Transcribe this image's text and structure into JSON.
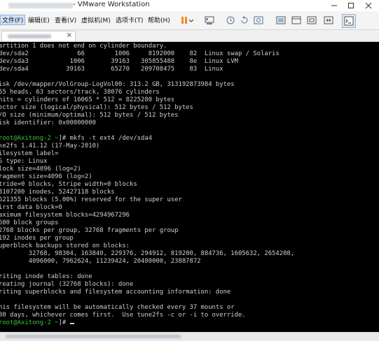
{
  "window": {
    "title": "VMware Workstation",
    "minimize_icon": "minimize-icon",
    "maximize_icon": "maximize-icon",
    "close_icon": "close-icon"
  },
  "menu": {
    "items": [
      "文件(F)",
      "编辑(E)",
      "查看(V)",
      "虚拟机(M)",
      "选项卡(T)",
      "帮助(H)"
    ],
    "active_index": 0
  },
  "toolbar": {
    "icons": [
      "pause-icon",
      "dropdown-icon",
      "send-ctrl-alt-del-icon",
      "snapshot-icon",
      "revert-snapshot-icon",
      "snapshot-manager-icon",
      "fullscreen-icon",
      "unity-icon",
      "console-view-icon",
      "stretch-icon",
      "terminal-icon"
    ],
    "pause_color": "#f28c1e"
  },
  "tab": {
    "close_label": "×"
  },
  "terminal": {
    "prompt_color": "#3cc53c",
    "text_color": "#cfcfcf",
    "lines": [
      {
        "text": "artition 1 does not end on cylinder boundary."
      },
      {
        "text": "dev/sda2             66        1006     8192000    82  Linux swap / Solaris"
      },
      {
        "text": "dev/sda3           1006       39163   305855488    8e  Linux LVM"
      },
      {
        "text": "dev/sda4          39163       65270   209708475    83  Linux"
      },
      {
        "text": ""
      },
      {
        "text": "isk /dev/mapper/VolGroup-LogVol00: 313.2 GB, 313192873984 bytes"
      },
      {
        "text": "55 heads, 63 sectors/track, 38076 cylinders"
      },
      {
        "text": "nits = cylinders of 16065 * 512 = 8225280 bytes"
      },
      {
        "text": "ector size (logical/physical): 512 bytes / 512 bytes"
      },
      {
        "text": "/O size (minimum/optimal): 512 bytes / 512 bytes"
      },
      {
        "text": "isk identifier: 0x00000000"
      },
      {
        "text": ""
      },
      {
        "prompt": "root@Axitong-2 ~",
        "text": "]# mkfs -t ext4 /dev/sda4"
      },
      {
        "text": "ke2fs 1.41.12 (17-May-2010)"
      },
      {
        "text": "ilesystem label="
      },
      {
        "text": "S type: Linux"
      },
      {
        "text": "lock size=4096 (log=2)"
      },
      {
        "text": "ragment size=4096 (log=2)"
      },
      {
        "text": "tride=0 blocks, Stripe width=0 blocks"
      },
      {
        "text": "3107200 inodes, 52427118 blocks"
      },
      {
        "text": "621355 blocks (5.00%) reserved for the super user"
      },
      {
        "text": "irst data block=0"
      },
      {
        "text": "aximum filesystem blocks=4294967296"
      },
      {
        "text": "600 block groups"
      },
      {
        "text": "2768 blocks per group, 32768 fragments per group"
      },
      {
        "text": "192 inodes per group"
      },
      {
        "text": "uperblock backups stored on blocks:"
      },
      {
        "text": "        32768, 98304, 163840, 229376, 294912, 819200, 884736, 1605632, 2654208,"
      },
      {
        "text": "        4096000, 7962624, 11239424, 20480000, 23887872"
      },
      {
        "text": ""
      },
      {
        "text": "riting inode tables: done"
      },
      {
        "text": "reating journal (32768 blocks): done"
      },
      {
        "text": "riting superblocks and filesystem accounting information: done"
      },
      {
        "text": ""
      },
      {
        "text": "his filesystem will be automatically checked every 37 mounts or"
      },
      {
        "text": "80 days, whichever comes first.  Use tune2fs -c or -i to override."
      },
      {
        "prompt": "root@Axitong-2 ~",
        "text": "]# ",
        "cursor": true
      }
    ]
  }
}
